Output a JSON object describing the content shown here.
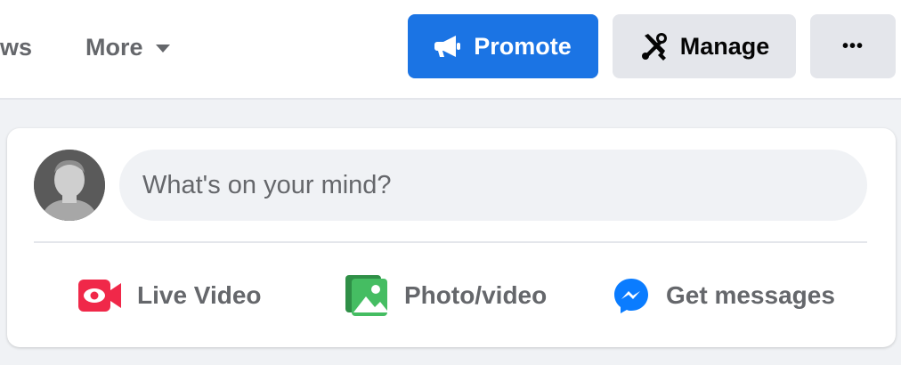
{
  "nav": {
    "partial_tab": "ws",
    "more_label": "More"
  },
  "actions": {
    "promote_label": "Promote",
    "manage_label": "Manage",
    "more_menu_label": "•••"
  },
  "composer": {
    "placeholder": "What's on your mind?",
    "live_video_label": "Live Video",
    "photo_video_label": "Photo/video",
    "get_messages_label": "Get messages"
  },
  "icons": {
    "promote": "megaphone-icon",
    "manage": "tools-icon",
    "live_video": "live-video-icon",
    "photo_video": "photo-icon",
    "messages": "messenger-icon",
    "more_caret": "caret-down-icon"
  },
  "colors": {
    "primary": "#1b74e4",
    "live_red": "#f02849",
    "photo_green": "#45bd62",
    "messenger_blue": "#0a7cff"
  }
}
